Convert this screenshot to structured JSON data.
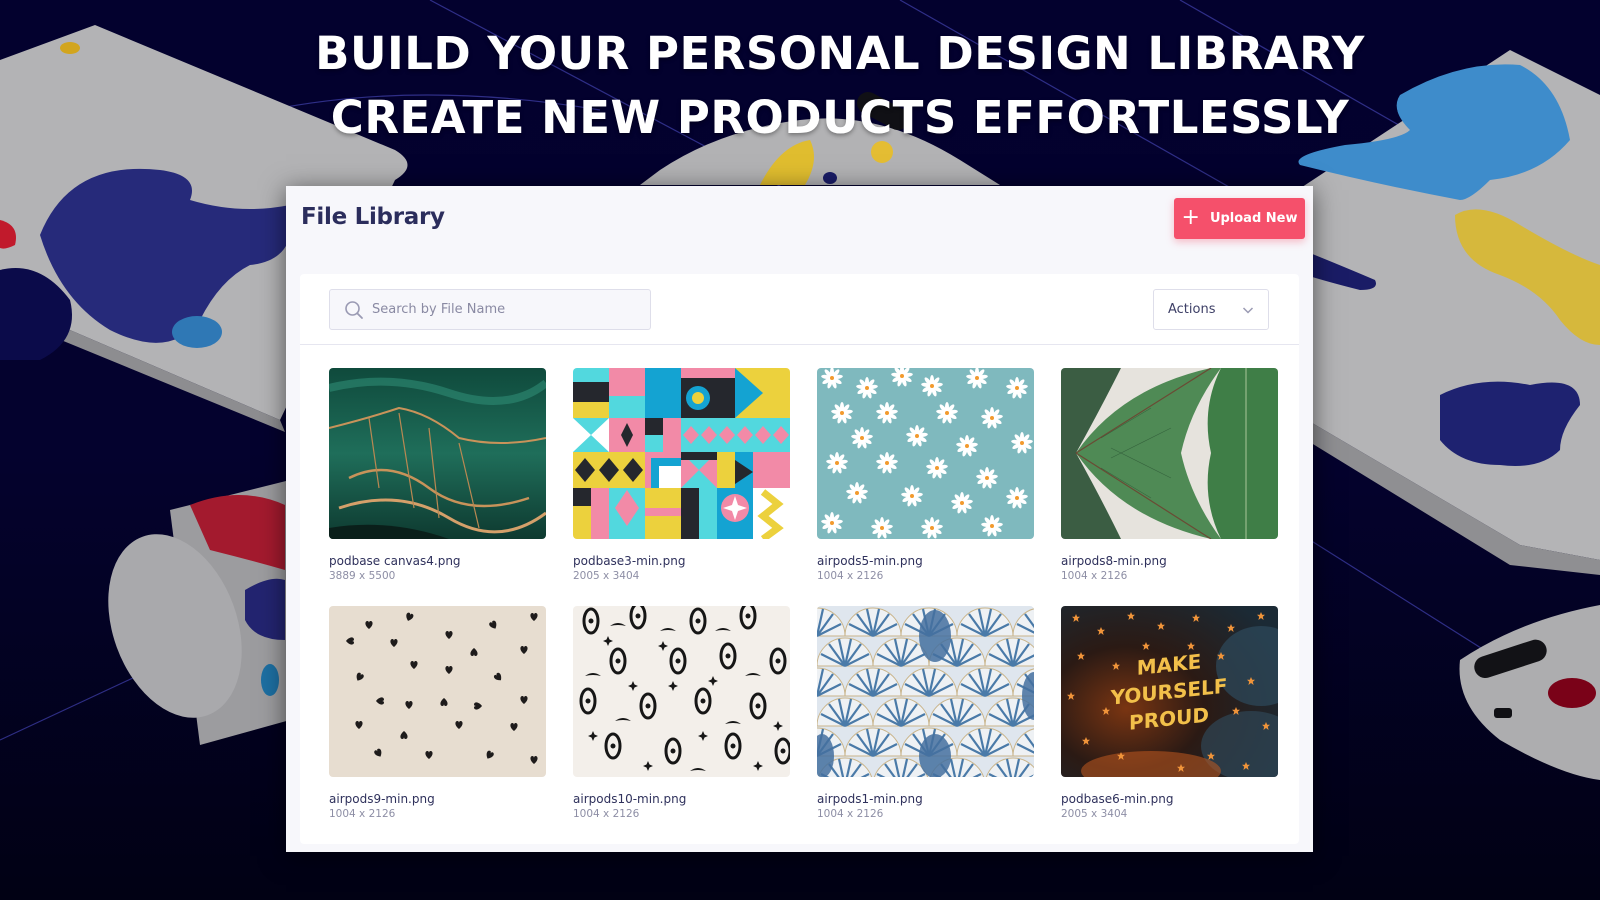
{
  "headline": {
    "line1": "BUILD YOUR PERSONAL DESIGN LIBRARY",
    "line2": "CREATE NEW PRODUCTS EFFORTLESSLY"
  },
  "colors": {
    "background": "#03012e",
    "accent": "#f5506b",
    "title": "#2b2d5c",
    "panel": "#f7f7fb"
  },
  "library": {
    "title": "File Library",
    "upload_button": {
      "icon": "plus-icon",
      "label": "Upload New"
    },
    "search": {
      "icon": "search-icon",
      "placeholder": "Search by File Name",
      "value": ""
    },
    "actions_dropdown": {
      "label": "Actions",
      "icon": "chevron-down-icon"
    },
    "files": [
      {
        "name": "podbase canvas4.png",
        "dimensions": "3889 x 5500",
        "thumbnail": "green-gold-marble"
      },
      {
        "name": "podbase3-min.png",
        "dimensions": "2005 x 3404",
        "thumbnail": "geometric-color-blocks"
      },
      {
        "name": "airpods5-min.png",
        "dimensions": "1004 x 2126",
        "thumbnail": "daisies-on-teal"
      },
      {
        "name": "airpods8-min.png",
        "dimensions": "1004 x 2126",
        "thumbnail": "tropical-leaves"
      },
      {
        "name": "airpods9-min.png",
        "dimensions": "1004 x 2126",
        "thumbnail": "black-hearts-on-beige"
      },
      {
        "name": "airpods10-min.png",
        "dimensions": "1004 x 2126",
        "thumbnail": "eyes-and-stars"
      },
      {
        "name": "airpods1-min.png",
        "dimensions": "1004 x 2126",
        "thumbnail": "blue-shell-fans"
      },
      {
        "name": "podbase6-min.png",
        "dimensions": "2005 x 3404",
        "thumbnail": "make-yourself-proud",
        "thumbnail_text": [
          "MAKE",
          "YOURSELF",
          "PROUD"
        ]
      }
    ]
  }
}
